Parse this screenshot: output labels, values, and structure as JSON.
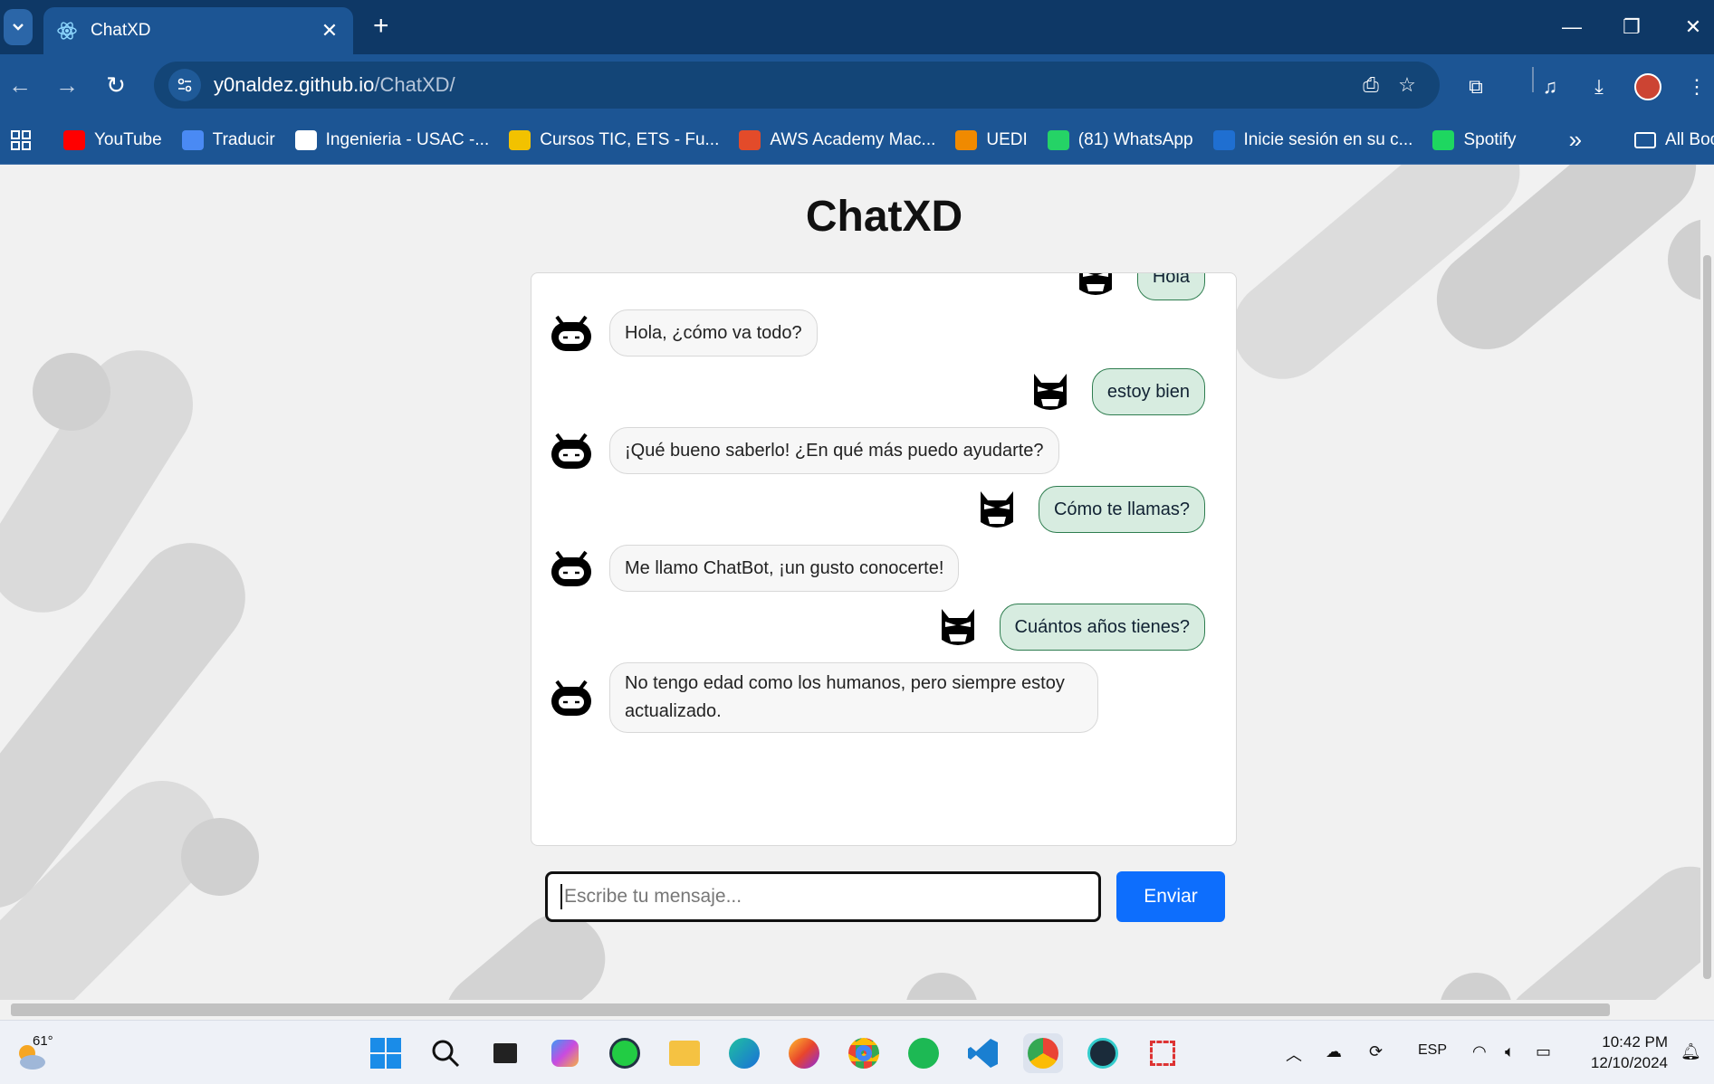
{
  "browser": {
    "tab_title": "ChatXD",
    "url_host": "y0naldez.github.io",
    "url_path": "/ChatXD/",
    "bookmarks": [
      {
        "label": "YouTube",
        "color": "#ff0000"
      },
      {
        "label": "Traducir",
        "color": "#4a8af4"
      },
      {
        "label": "Ingenieria - USAC -...",
        "color": "#ffffff"
      },
      {
        "label": "Cursos TIC, ETS - Fu...",
        "color": "#f2c200"
      },
      {
        "label": "AWS Academy Mac...",
        "color": "#e34b2a"
      },
      {
        "label": "UEDI",
        "color": "#f08a00"
      },
      {
        "label": "(81) WhatsApp",
        "color": "#25d366"
      },
      {
        "label": "Inicie sesión en su c...",
        "color": "#1f6fd1"
      },
      {
        "label": "Spotify",
        "color": "#1ed760"
      }
    ],
    "overflow_label": "»",
    "all_bookmarks": "All Bookmarks"
  },
  "app": {
    "title": "ChatXD",
    "messages": [
      {
        "role": "user",
        "text": "Hola"
      },
      {
        "role": "bot",
        "text": "Hola, ¿cómo va todo?"
      },
      {
        "role": "user",
        "text": "estoy bien"
      },
      {
        "role": "bot",
        "text": "¡Qué bueno saberlo! ¿En qué más puedo ayudarte?"
      },
      {
        "role": "user",
        "text": "Cómo te llamas?"
      },
      {
        "role": "bot",
        "text": "Me llamo ChatBot, ¡un gusto conocerte!"
      },
      {
        "role": "user",
        "text": "Cuántos años tienes?"
      },
      {
        "role": "bot",
        "text": "No tengo edad como los humanos, pero siempre estoy actualizado."
      }
    ],
    "input_placeholder": "Escribe tu mensaje...",
    "send_label": "Enviar"
  },
  "taskbar": {
    "temperature": "61°",
    "lang": "ESP",
    "time": "10:42 PM",
    "date": "12/10/2024"
  }
}
